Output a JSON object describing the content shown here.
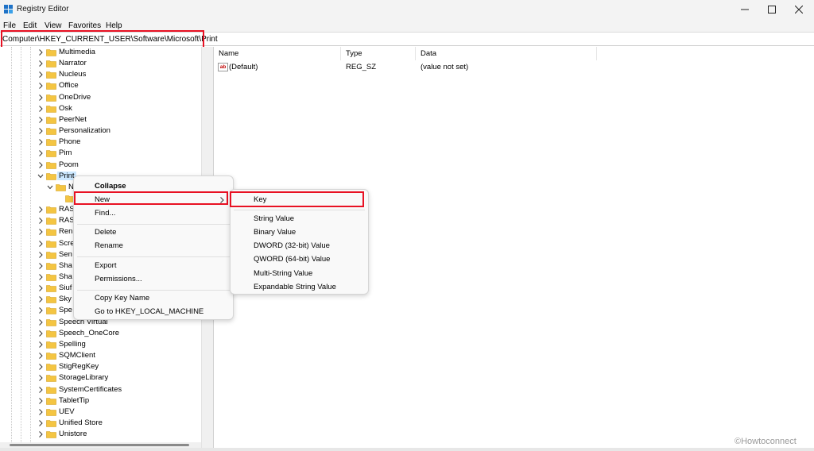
{
  "window": {
    "title": "Registry Editor",
    "icon": "registry-editor-icon",
    "controls": [
      "minimize-icon",
      "maximize-icon",
      "close-icon"
    ]
  },
  "menubar": [
    "File",
    "Edit",
    "View",
    "Favorites",
    "Help"
  ],
  "address": {
    "path": "Computer\\HKEY_CURRENT_USER\\Software\\Microsoft\\Print"
  },
  "tree": {
    "items": [
      {
        "label": "Multimedia"
      },
      {
        "label": "Narrator"
      },
      {
        "label": "Nucleus"
      },
      {
        "label": "Office"
      },
      {
        "label": "OneDrive"
      },
      {
        "label": "Osk"
      },
      {
        "label": "PeerNet"
      },
      {
        "label": "Personalization"
      },
      {
        "label": "Phone"
      },
      {
        "label": "Pim"
      },
      {
        "label": "Poom"
      },
      {
        "label": "Print",
        "expanded": true,
        "selected": true
      },
      {
        "label": "N",
        "level": 2,
        "expanded": true
      },
      {
        "label": "",
        "level": 3
      },
      {
        "label": "RAS"
      },
      {
        "label": "RAS"
      },
      {
        "label": "Ren"
      },
      {
        "label": "Scre"
      },
      {
        "label": "Sen"
      },
      {
        "label": "Sha"
      },
      {
        "label": "Sha"
      },
      {
        "label": "Siuf"
      },
      {
        "label": "Sky"
      },
      {
        "label": "Spe"
      },
      {
        "label": "Speech Virtual"
      },
      {
        "label": "Speech_OneCore"
      },
      {
        "label": "Spelling"
      },
      {
        "label": "SQMClient"
      },
      {
        "label": "StigRegKey"
      },
      {
        "label": "StorageLibrary"
      },
      {
        "label": "SystemCertificates"
      },
      {
        "label": "TabletTip"
      },
      {
        "label": "UEV"
      },
      {
        "label": "Unified Store"
      },
      {
        "label": "Unistore"
      }
    ]
  },
  "values": {
    "columns": [
      "Name",
      "Type",
      "Data"
    ],
    "rows": [
      {
        "name": "(Default)",
        "type": "REG_SZ",
        "data": "(value not set)",
        "icon": "string-value-icon"
      }
    ]
  },
  "context_menu": {
    "items": [
      "Collapse",
      "New",
      "Find...",
      "Delete",
      "Rename",
      "Export",
      "Permissions...",
      "Copy Key Name",
      "Go to HKEY_LOCAL_MACHINE"
    ]
  },
  "submenu": {
    "items": [
      "Key",
      "String Value",
      "Binary Value",
      "DWORD (32-bit) Value",
      "QWORD (64-bit) Value",
      "Multi-String Value",
      "Expandable String Value"
    ]
  },
  "watermark": "©Howtoconnect",
  "colors": {
    "highlight_box": "#e81123",
    "selection": "#cce8ff",
    "folder": "#f4c542"
  }
}
